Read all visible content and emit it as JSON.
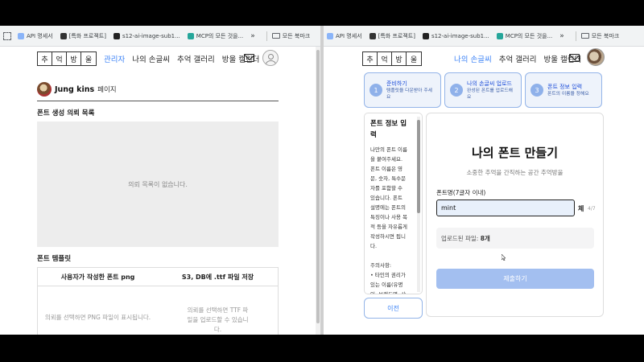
{
  "left_browser": {
    "bookmarks": [
      {
        "label": "API 명세서",
        "icon": "doc-favicon",
        "color": "#8ab4f8"
      },
      {
        "label": "[특화 프로젝트]",
        "icon": "notion-favicon",
        "color": "#333333"
      },
      {
        "label": "s12-ai-image-sub1...",
        "icon": "terminal-favicon",
        "color": "#222222"
      },
      {
        "label": "MCP의 모든 것을...",
        "icon": "v-favicon",
        "color": "#26a69a"
      }
    ],
    "more": "»",
    "all_bookmarks": "모든 북마크"
  },
  "right_browser": {
    "bookmarks": [
      {
        "label": "API 명세서",
        "icon": "doc-favicon",
        "color": "#8ab4f8"
      },
      {
        "label": "[특화 프로젝트]",
        "icon": "notion-favicon",
        "color": "#333333"
      },
      {
        "label": "s12-ai-image-sub1...",
        "icon": "terminal-favicon",
        "color": "#222222"
      },
      {
        "label": "MCP의 모든 것을...",
        "icon": "v-favicon",
        "color": "#26a69a"
      }
    ],
    "more": "»",
    "all_bookmarks": "모든 북마크"
  },
  "logo_chars": [
    "추",
    "억",
    "방",
    "울"
  ],
  "left_page": {
    "nav": {
      "admin": "관리자",
      "links": [
        "나의 손글씨",
        "추억 갤러리",
        "방울 캘린더"
      ]
    },
    "user": {
      "name": "Jung kins",
      "suffix": "페이지"
    },
    "request_title": "폰트 생성 의뢰 목록",
    "empty_text": "의뢰 목록이 없습니다.",
    "template_title": "폰트 템플릿",
    "template_headers": [
      "사용자가 작성한 폰트 png",
      "S3, DB에 .ttf 파일 저장"
    ],
    "template_cells": [
      "의뢰를 선택하면 PNG 파일이 표시됩니다.",
      "의뢰를 선택하면 TTF 파\n일을 업로드할 수 있습니\n다."
    ]
  },
  "right_page": {
    "nav": {
      "links": [
        "나의 손글씨",
        "추억 갤러리",
        "방울 캘린더"
      ]
    },
    "steps": [
      {
        "num": "1",
        "title": "준비하기",
        "desc": "템플릿을 다운받아 주세\n요"
      },
      {
        "num": "2",
        "title": "나의 손글씨 업로드",
        "desc": "완성된 폰트를 업로드해\n요"
      },
      {
        "num": "3",
        "title": "폰트 정보 입력",
        "desc": "폰트의 이름을 정해요"
      }
    ],
    "info": {
      "title": "폰트 정보 입\n력",
      "body": "나만의 폰트 이름\n을 붙여주세요.\n폰트 이름은 영\n문, 숫자, 특수문\n자를 포함할 수\n있습니다. 폰트\n설명에는 폰트의\n특징이나 사용 목\n적 등을 자유롭게\n작성하시면 됩니\n다.",
      "notes": "주의사항:\n• 타인의 권리가\n있는 이름(유명\n인, 브랜드명, 상"
    },
    "prev_button": "이전",
    "title": "나의 폰트 만들기",
    "subtitle": "소중한 추억을 간직하는 공간 추억방울",
    "field_label": "폰트명(7글자 이내)",
    "field_value": "mint",
    "field_suffix": "체",
    "counter": "4/7",
    "uploaded_label": "업로드된 파일: ",
    "uploaded_count": "8개",
    "submit": "제출하기"
  }
}
